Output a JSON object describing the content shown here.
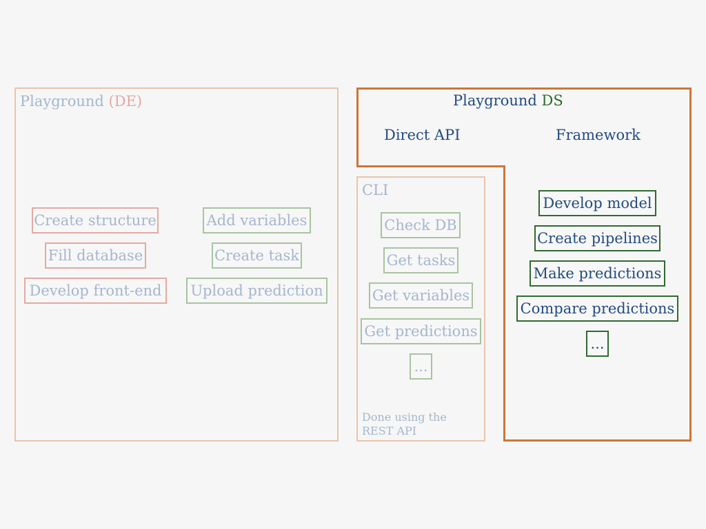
{
  "de_panel": {
    "title_main": "Playground",
    "title_tag": "(DE)",
    "left_items": [
      "Create structure",
      "Fill database",
      "Develop front-end"
    ],
    "right_items": [
      "Add variables",
      "Create task",
      "Upload prediction"
    ]
  },
  "ds_panel": {
    "title_main": "Playground",
    "title_tag": "DS",
    "direct_api_label": "Direct API",
    "framework_label": "Framework",
    "framework_items": [
      "Develop model",
      "Create pipelines",
      "Make predictions",
      "Compare predictions",
      "..."
    ]
  },
  "cli_panel": {
    "title": "CLI",
    "items": [
      "Check DB",
      "Get tasks",
      "Get variables",
      "Get predictions",
      "..."
    ],
    "footnote_line1": "Done using the",
    "footnote_line2": "REST API"
  },
  "colors": {
    "de_accent": "#e3a9a2",
    "ds_accent": "#2f6a2f",
    "ds_border": "#cf7437",
    "muted_text": "#a4b6cf",
    "dark_text": "#234b80"
  }
}
